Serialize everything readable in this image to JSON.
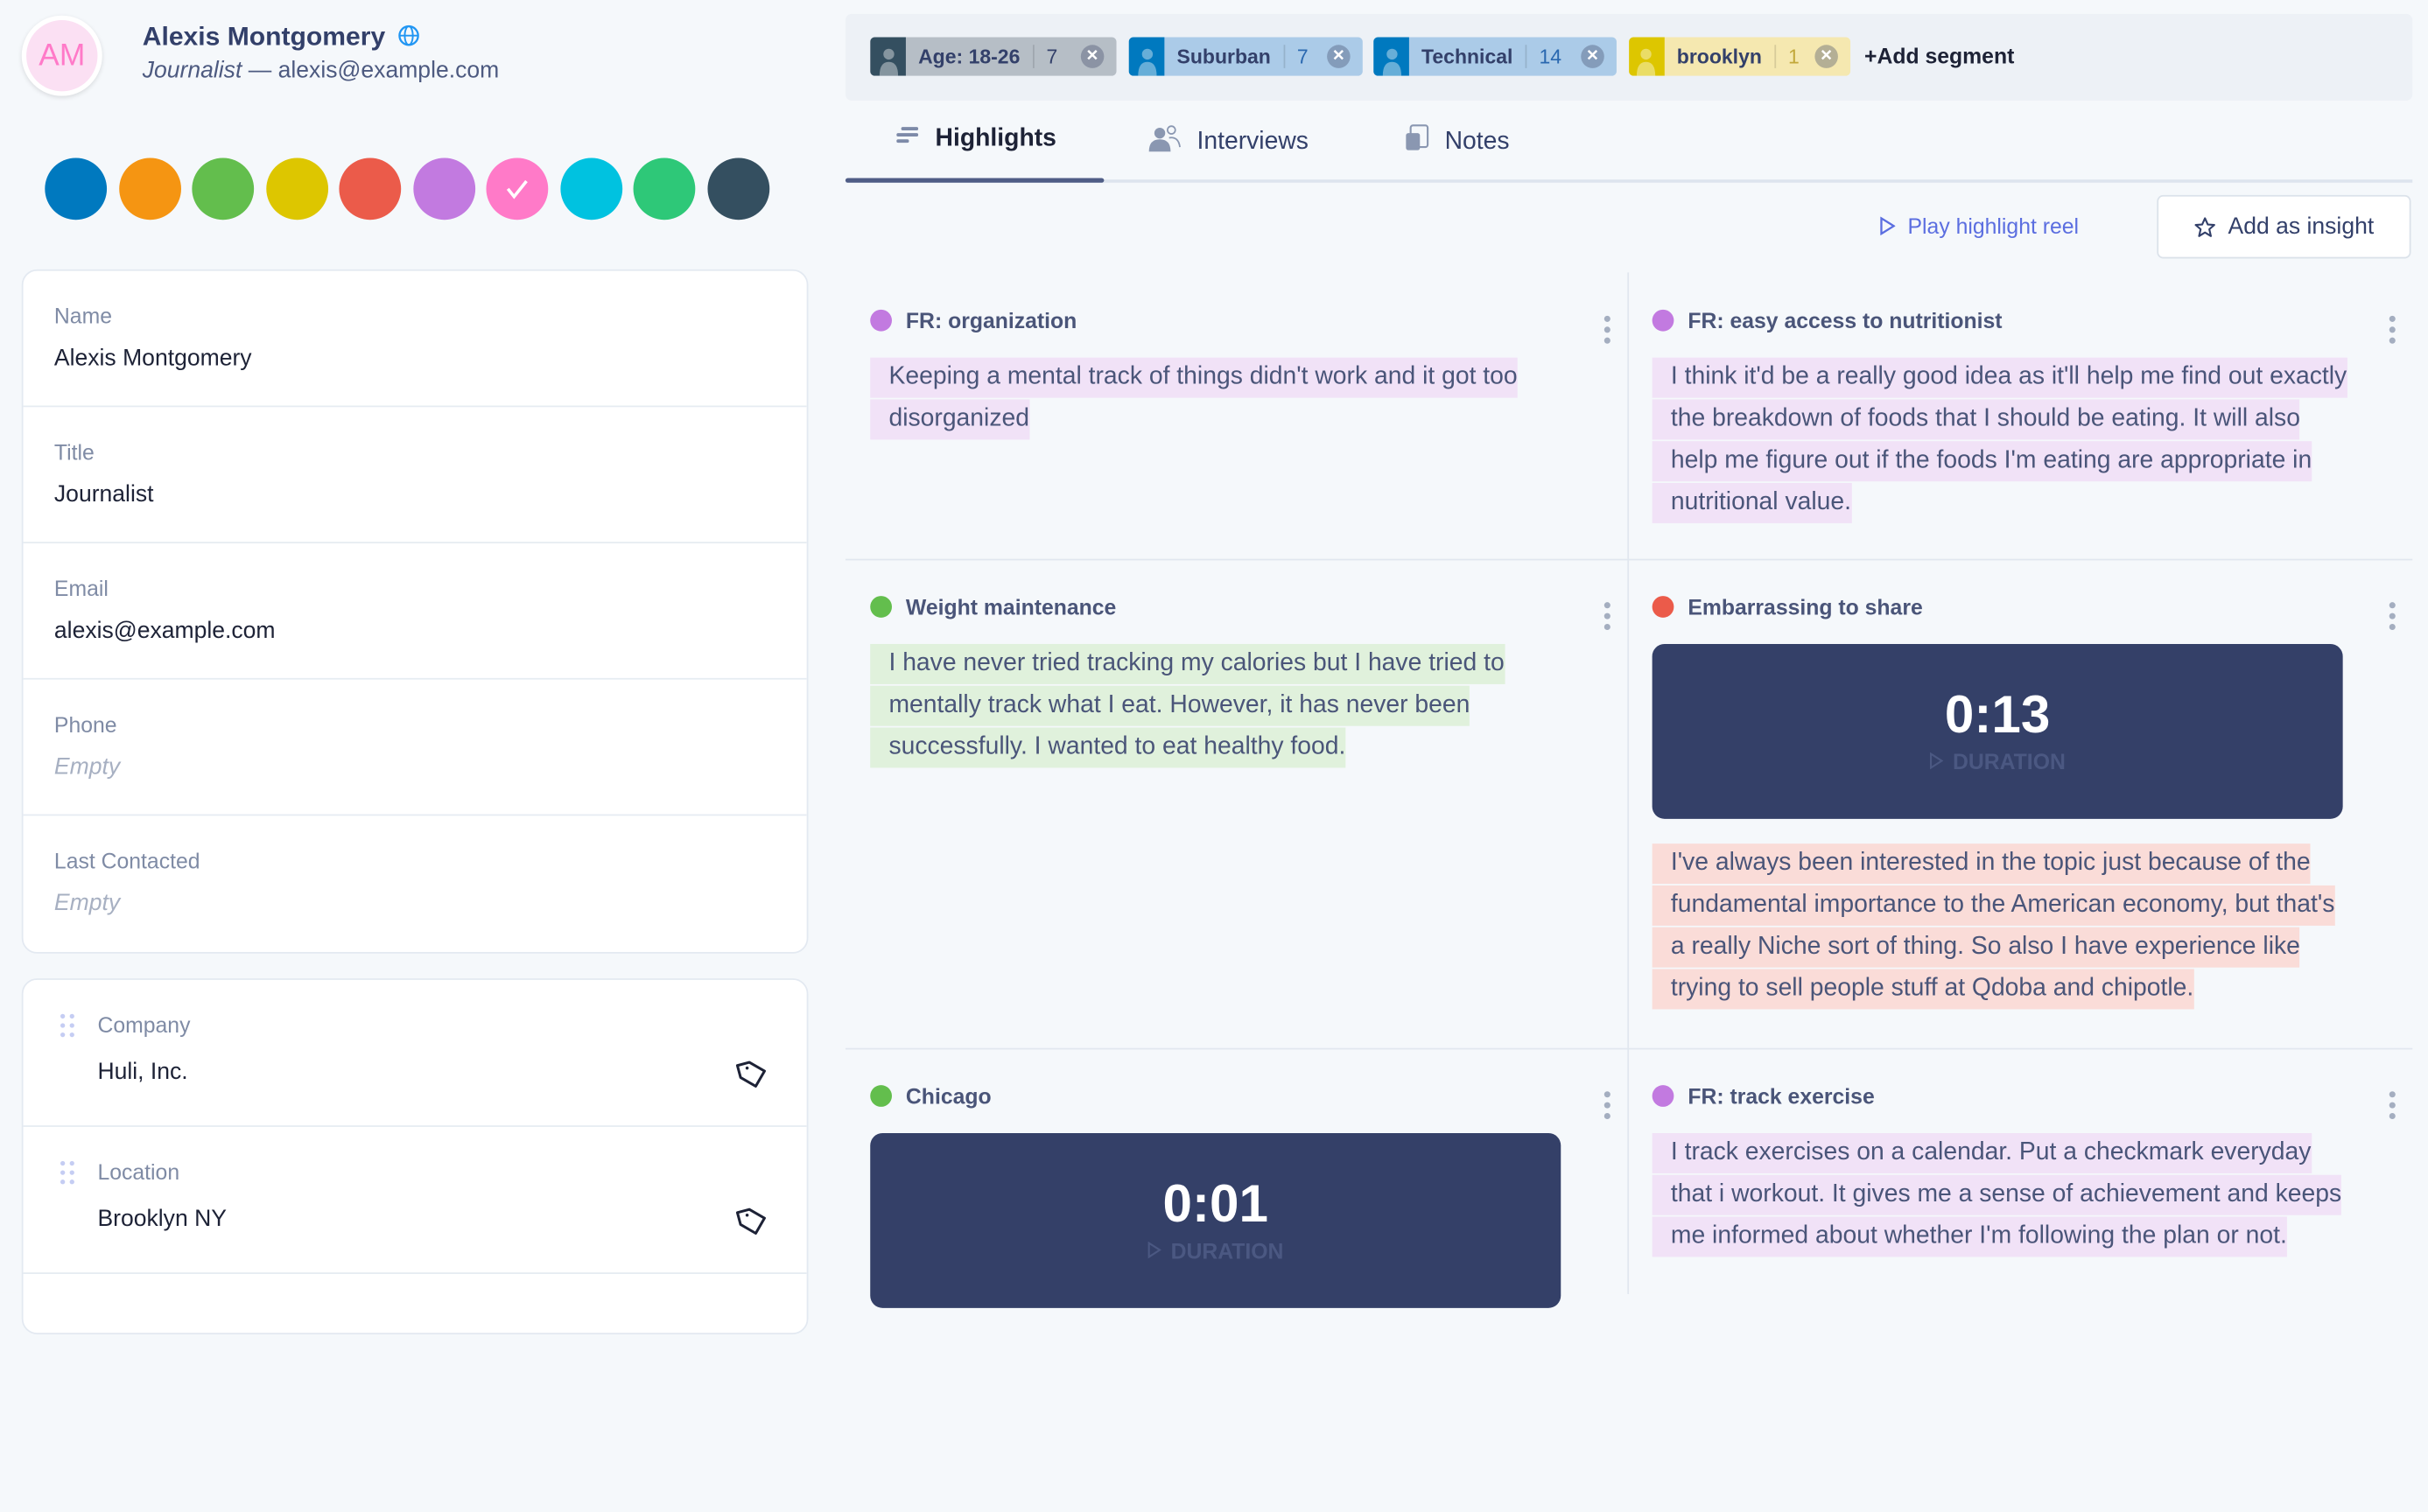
{
  "profile": {
    "initials": "AM",
    "name": "Alexis Montgomery",
    "title": "Journalist",
    "separator": " — ",
    "email": "alexis@example.com",
    "avatar_color": "#ff7ac8",
    "globe_icon": "globe-icon"
  },
  "color_options": [
    {
      "color": "#0079bf",
      "selected": false
    },
    {
      "color": "#f59512",
      "selected": false
    },
    {
      "color": "#63be4d",
      "selected": false
    },
    {
      "color": "#ddc600",
      "selected": false
    },
    {
      "color": "#eb5b4a",
      "selected": false
    },
    {
      "color": "#c27ae0",
      "selected": false
    },
    {
      "color": "#ff7ac8",
      "selected": true
    },
    {
      "color": "#00c2e0",
      "selected": false
    },
    {
      "color": "#2ec878",
      "selected": false
    },
    {
      "color": "#344f60",
      "selected": false
    }
  ],
  "fields": [
    {
      "label": "Name",
      "value": "Alexis Montgomery"
    },
    {
      "label": "Title",
      "value": "Journalist"
    },
    {
      "label": "Email",
      "value": "alexis@example.com"
    },
    {
      "label": "Phone",
      "value": "Empty",
      "empty": true
    },
    {
      "label": "Last Contacted",
      "value": "Empty",
      "empty": true
    }
  ],
  "custom_fields": [
    {
      "label": "Company",
      "value": "Huli, Inc."
    },
    {
      "label": "Location",
      "value": "Brooklyn NY"
    }
  ],
  "segments": [
    {
      "label": "Age: 18-26",
      "count": "7",
      "color": "#344f60",
      "bg": "#b6bec6",
      "text": "#33406a",
      "count_color": "#33406a"
    },
    {
      "label": "Suburban",
      "count": "7",
      "color": "#0079bf",
      "bg": "#abcbe8",
      "text": "#33406a",
      "count_color": "#2a68b0"
    },
    {
      "label": "Technical",
      "count": "14",
      "color": "#0079bf",
      "bg": "#abcbe8",
      "text": "#33406a",
      "count_color": "#2a68b0"
    },
    {
      "label": "brooklyn",
      "count": "1",
      "color": "#ddc600",
      "bg": "#f5e8b0",
      "text": "#33406a",
      "count_color": "#c2a83a"
    }
  ],
  "add_segment": "+Add segment",
  "tabs": [
    {
      "label": "Highlights",
      "icon": "highlights-icon",
      "active": true
    },
    {
      "label": "Interviews",
      "icon": "interviews-icon",
      "active": false
    },
    {
      "label": "Notes",
      "icon": "notes-icon",
      "active": false
    }
  ],
  "actions": {
    "play_reel": "Play highlight reel",
    "add_insight": "Add as insight"
  },
  "highlights": [
    {
      "tag": "FR: organization",
      "color": "#c27ae0",
      "bg": "#f1e2f7",
      "quote": "Keeping a mental track of things didn't work and it got too disorganized"
    },
    {
      "tag": "FR: easy access to nutritionist",
      "color": "#c27ae0",
      "bg": "#f1e2f7",
      "quote": "I think it'd be a really good idea as it'll help me find out exactly the breakdown of foods that I should be eating. It will also help me figure out if the foods I'm eating are appropriate in nutritional value."
    },
    {
      "tag": "Weight maintenance",
      "color": "#63be4d",
      "bg": "#e0f1dc",
      "quote": "I have never tried tracking my calories but I have tried to mentally track what I eat. However, it has never been successfully. I wanted to eat healthy food."
    },
    {
      "tag": "Embarrassing to share",
      "color": "#eb5b4a",
      "bg": "#fadcd8",
      "video": {
        "time": "0:13",
        "label": "DURATION"
      },
      "quote": "I've always been interested in the topic just because of the fundamental importance to the American economy, but that's a really Niche sort of thing. So also I have experience like trying to sell people stuff at Qdoba and chipotle."
    },
    {
      "tag": "Chicago",
      "color": "#63be4d",
      "bg": "#e0f1dc",
      "video": {
        "time": "0:01",
        "label": "DURATION"
      }
    },
    {
      "tag": "FR: track exercise",
      "color": "#c27ae0",
      "bg": "#f1e2f7",
      "quote": "I track exercises on a calendar. Put a checkmark everyday that i workout. It gives me a sense of achievement and keeps me informed about whether I'm following the plan or not."
    }
  ]
}
